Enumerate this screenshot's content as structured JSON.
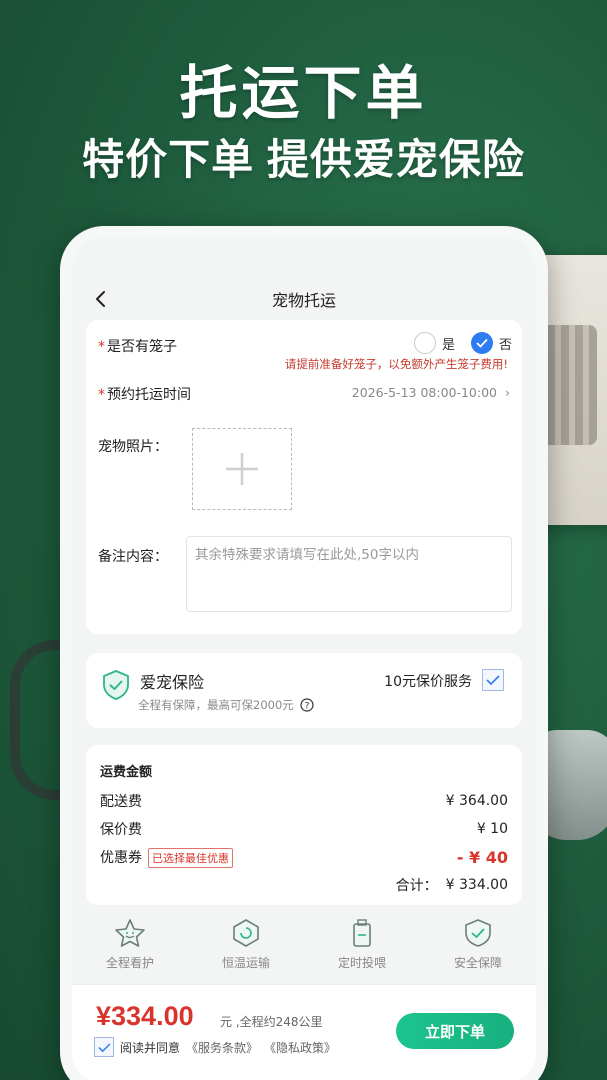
{
  "promo": {
    "title": "托运下单",
    "subtitle": "特价下单 提供爱宠保险"
  },
  "navbar": {
    "title": "宠物托运"
  },
  "form": {
    "cage": {
      "required": "*",
      "label": "是否有笼子",
      "option_yes": "是",
      "option_no": "否",
      "selected": "否",
      "hint": "请提前准备好笼子，以免额外产生笼子费用!"
    },
    "time": {
      "required": "*",
      "label": "预约托运时间",
      "value": "2026-5-13 08:00-10:00"
    },
    "photo": {
      "label": "宠物照片："
    },
    "remark": {
      "label": "备注内容：",
      "placeholder": "其余特殊要求请填写在此处,50字以内"
    }
  },
  "insurance": {
    "title": "爱宠保险",
    "subtitle": "全程有保障，最高可保2000元",
    "service": "10元保价服务",
    "checked": true,
    "accent": "#2fb58a"
  },
  "fees": {
    "title": "运费金额",
    "delivery_label": "配送费",
    "delivery_value": "¥ 364.00",
    "insured_label": "保价费",
    "insured_value": "¥ 10",
    "coupon_label": "优惠券",
    "coupon_badge": "已选择最佳优惠",
    "coupon_value": "- ¥ 40",
    "total_label": "合计：",
    "total_value": "¥ 334.00"
  },
  "features": [
    {
      "label": "全程看护",
      "icon": "star-face-icon"
    },
    {
      "label": "恒温运输",
      "icon": "thermo-cycle-icon"
    },
    {
      "label": "定时投喂",
      "icon": "food-box-icon"
    },
    {
      "label": "安全保障",
      "icon": "shield-check-icon"
    }
  ],
  "checkout": {
    "price": "¥334.00",
    "unit_text": "元 ,全程约248公里",
    "agree_text": "阅读并同意",
    "terms_link": "《服务条款》",
    "privacy_link": "《隐私政策》",
    "order_button": "立即下单"
  },
  "colors": {
    "brand_green": "#1cc48e",
    "price_red": "#d9342b",
    "radio_blue": "#2d7cf3"
  }
}
